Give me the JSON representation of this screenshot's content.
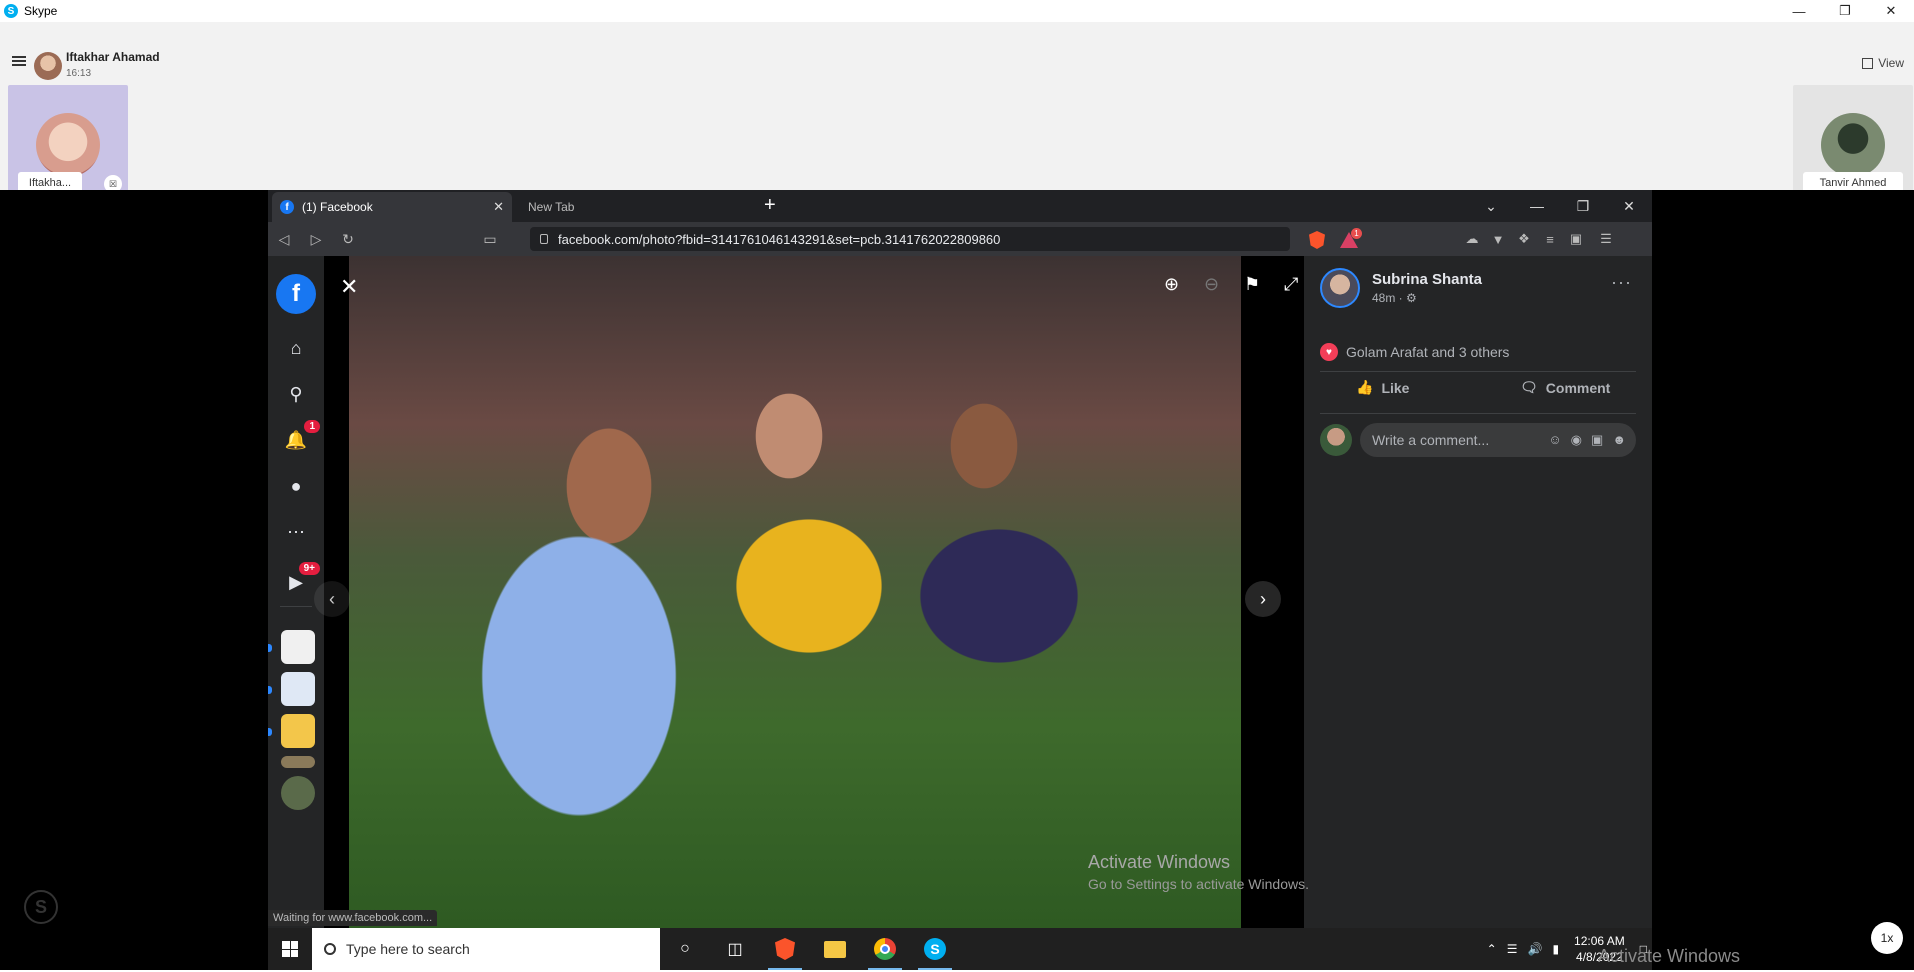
{
  "skype": {
    "app_title": "Skype",
    "caller_name": "Iftakhar Ahamad",
    "call_duration": "16:13",
    "view_label": "View",
    "participants": [
      {
        "name": "Iftakha..."
      },
      {
        "name": "Tanvir Ahmed"
      }
    ],
    "speed_label": "1x"
  },
  "browser": {
    "tabs": [
      {
        "label": "(1) Facebook",
        "active": true
      },
      {
        "label": "New Tab",
        "active": false
      }
    ],
    "url": "facebook.com/photo?fbid=3141761046143291&set=pcb.3141762022809860",
    "rewards_count": "1",
    "status_text": "Waiting for www.facebook.com..."
  },
  "facebook": {
    "notifications_badge": "1",
    "watch_badge": "9+",
    "post": {
      "author": "Subrina Shanta",
      "time": "48m ·",
      "reactions_text": "Golam Arafat and 3 others",
      "like_label": "Like",
      "comment_label": "Comment",
      "comment_placeholder": "Write a comment..."
    }
  },
  "windows": {
    "activation_title": "Activate Windows",
    "activation_subtitle": "Go to Settings to activate Windows.",
    "search_placeholder": "Type here to search",
    "time": "12:06 AM",
    "date": "4/8/2022",
    "watermark": "Activate Windows"
  },
  "colors": {
    "facebook_blue": "#1877f2",
    "skype_blue": "#00aff0",
    "brave_orange": "#fb542b",
    "badge_red": "#e41e3f"
  }
}
